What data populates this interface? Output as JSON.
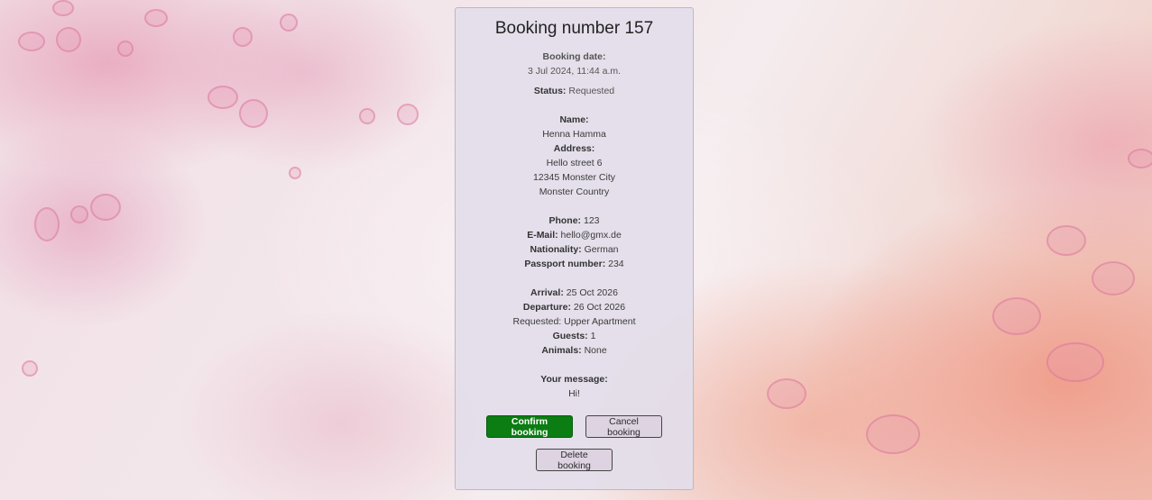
{
  "booking": {
    "title": "Booking number 157",
    "date_label": "Booking date:",
    "date_value": "3 Jul 2024, 11:44 a.m.",
    "status_label": "Status:",
    "status_value": "Requested",
    "name_label": "Name:",
    "name_value": "Henna Hamma",
    "address_label": "Address:",
    "address_line1": "Hello street 6",
    "address_line2": "12345 Monster City",
    "address_line3": "Monster Country",
    "phone_label": "Phone:",
    "phone_value": "123",
    "email_label": "E-Mail:",
    "email_value": "hello@gmx.de",
    "nationality_label": "Nationality:",
    "nationality_value": "German",
    "passport_label": "Passport number:",
    "passport_value": "234",
    "arrival_label": "Arrival:",
    "arrival_value": "25 Oct 2026",
    "departure_label": "Departure:",
    "departure_value": "26 Oct 2026",
    "requested_text": "Requested: Upper Apartment",
    "guests_label": "Guests:",
    "guests_value": "1",
    "animals_label": "Animals:",
    "animals_value": "None",
    "message_label": "Your message:",
    "message_value": "Hi!"
  },
  "actions": {
    "confirm_label": "Confirm booking",
    "cancel_label": "Cancel booking",
    "delete_label": "Delete booking"
  },
  "colors": {
    "confirm_bg": "#0b7d12",
    "card_bg": "#e2deea"
  }
}
